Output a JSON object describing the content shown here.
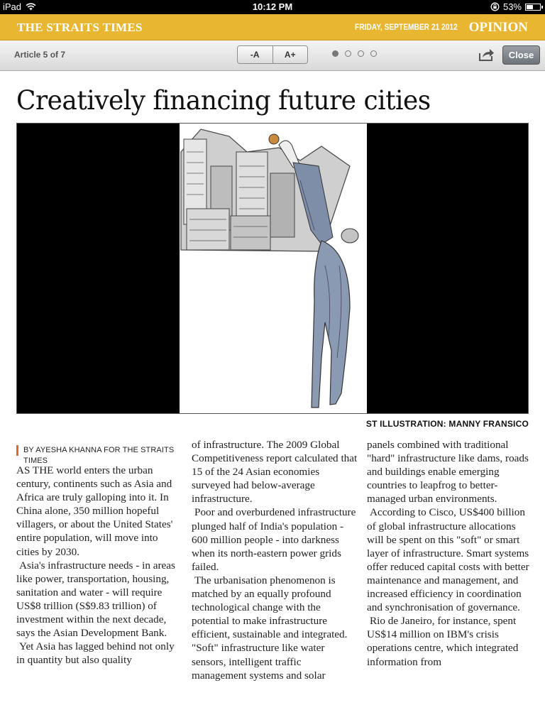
{
  "status_bar": {
    "device": "iPad",
    "time": "10:12 PM",
    "battery": "53%",
    "battery_level": 0.53
  },
  "masthead": {
    "brand": "THE STRAITS TIMES",
    "date": "FRIDAY, SEPTEMBER 21 2012",
    "section": "OPINION",
    "color": "#e8b631"
  },
  "toolbar": {
    "article_count": "Article 5 of 7",
    "font_decrease": "-A",
    "font_increase": "A+",
    "page_dots": 4,
    "active_dot": 1,
    "close_label": "Close"
  },
  "article": {
    "headline": "Creatively financing future cities",
    "image_caption": "ST ILLUSTRATION: MANNY FRANSICO",
    "byline": "BY AYESHA KHANNA FOR THE STRAITS TIMES",
    "columns": [
      [
        "AS THE world enters the urban century, continents such as Asia and Africa are truly galloping into it. In China alone, 350 million hopeful villagers, or about the United States' entire population, will move into cities by 2030.",
        "Asia's infrastructure needs - in areas like power, transportation, housing, sanitation and water - will require US$8 trillion (S$9.83 trillion) of investment within the next decade, says the Asian Development Bank.",
        "Yet Asia has lagged behind not only in quantity but also quality"
      ],
      [
        "of infrastructure. The 2009 Global Competitiveness report calculated that 15 of the 24 Asian economies surveyed had below-average infrastructure.",
        "Poor and overburdened infrastructure plunged half of India's population - 600 million people - into darkness when its north-eastern power grids failed.",
        "The urbanisation phenomenon is matched by an equally profound technological change with the potential to make infrastructure efficient, sustainable and integrated. \"Soft\" infrastructure like water sensors, intelligent traffic management systems and solar"
      ],
      [
        "panels combined with traditional \"hard\" infrastructure like dams, roads and buildings enable emerging countries to leapfrog to better-managed urban environments.",
        "According to Cisco, US$400 billion of global infrastructure allocations will be spent on this \"soft\" or smart layer of infrastructure. Smart systems offer reduced capital costs with better maintenance and management, and increased efficiency in coordination and synchronisation of governance.",
        "Rio de Janeiro, for instance, spent US$14 million on IBM's crisis operations centre, which integrated information from"
      ]
    ]
  }
}
